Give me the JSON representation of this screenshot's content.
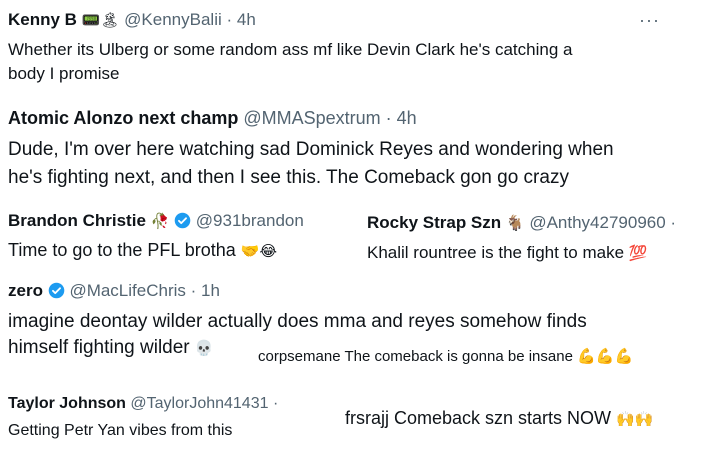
{
  "t1": {
    "name": "Kenny B",
    "emoji": "📟🏝",
    "handle": "@KennyBalii · 4h",
    "text1": "Whether its Ulberg or some random ass mf like Devin Clark he's catching a",
    "text2": "body I promise",
    "more": "···"
  },
  "t2": {
    "name": "Atomic Alonzo next champ",
    "handle": "@MMASpextrum · 4h",
    "text1": "Dude, I'm over here watching sad Dominick Reyes and wondering when",
    "text2": "he's fighting next, and then I see this. The Comeback gon go crazy"
  },
  "t3": {
    "name": "Brandon Christie",
    "emoji": "🥀",
    "handle": "@931brandon",
    "text": "Time to go to the PFL brotha",
    "text_emoji": "🤝😂"
  },
  "t4": {
    "name": "Rocky Strap Szn",
    "emoji": "🐐",
    "handle": "@Anthy42790960 ·",
    "text": "Khalil rountree is the fight to make",
    "text_emoji": "💯"
  },
  "t5": {
    "name": "zero",
    "handle": "@MacLifeChris · 1h",
    "text1": "imagine deontay wilder actually does mma and reyes somehow finds",
    "text2": "himself fighting wilder",
    "text_emoji": "💀"
  },
  "overlay1": {
    "text": "corpsemane The comeback is gonna be insane",
    "text_emoji": "💪💪💪"
  },
  "t6": {
    "name": "Taylor Johnson",
    "handle": "@TaylorJohn41431 ·",
    "text": "Getting Petr Yan vibes from this"
  },
  "overlay2": {
    "text": "frsrajj Comeback szn starts NOW",
    "text_emoji": "🙌🙌"
  },
  "colors": {
    "verified": "#1d9bf0",
    "text": "#0f1419",
    "muted": "#536471"
  }
}
